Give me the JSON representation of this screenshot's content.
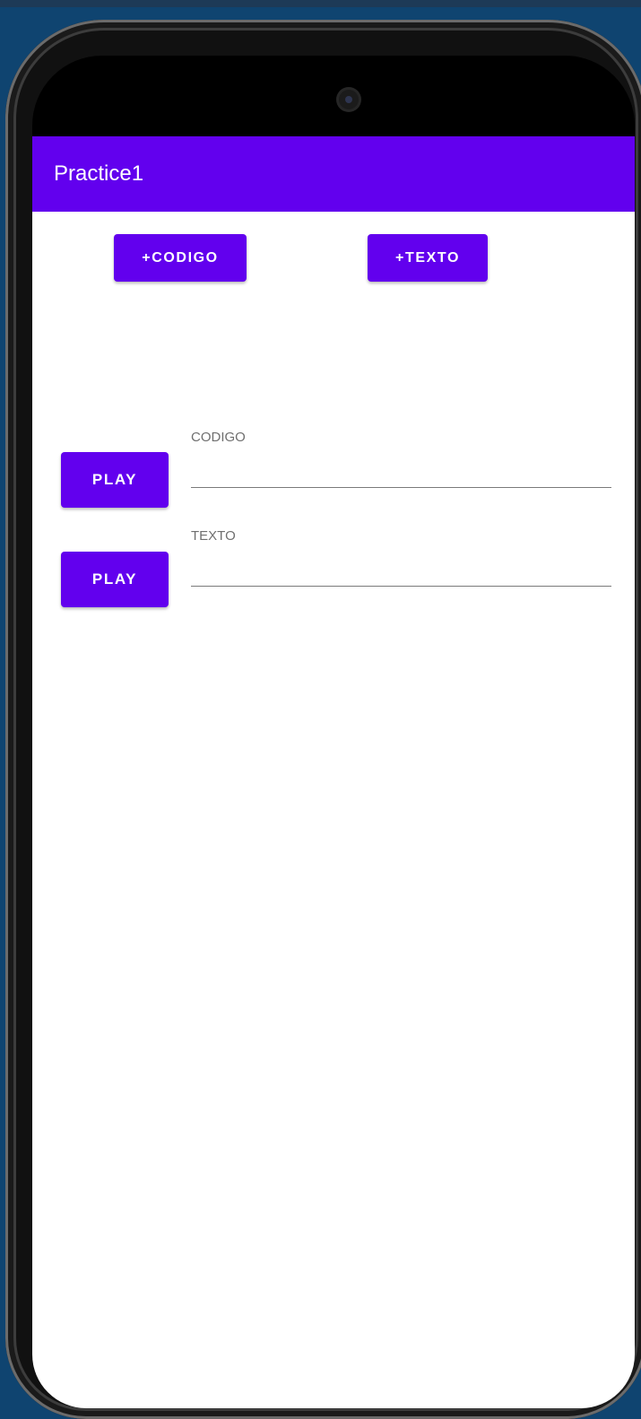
{
  "app": {
    "title": "Practice1"
  },
  "buttons": {
    "add_codigo": "+CODIGO",
    "add_texto": "+TEXTO",
    "play_codigo": "PLAY",
    "play_texto": "PLAY"
  },
  "fields": {
    "codigo": {
      "label": "CODIGO",
      "value": ""
    },
    "texto": {
      "label": "TEXTO",
      "value": ""
    }
  },
  "colors": {
    "primary": "#6200ee",
    "background": "#ffffff",
    "desktop": "#0f4470"
  }
}
